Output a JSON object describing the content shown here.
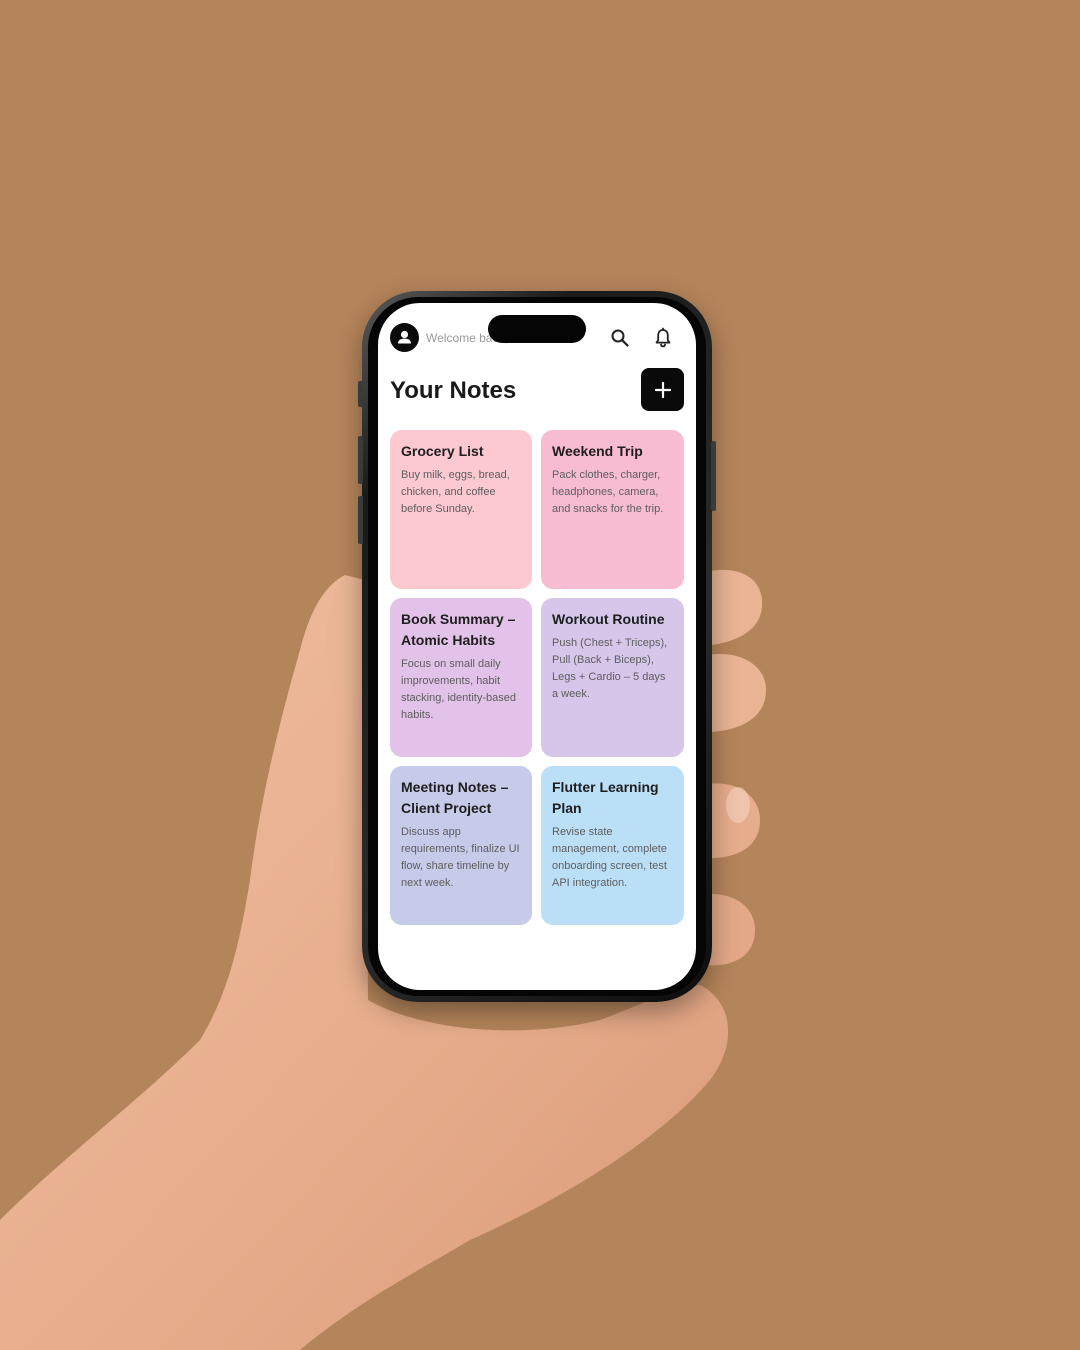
{
  "header": {
    "welcome_text": "Welcome back, Rahul",
    "title": "Your Notes",
    "add_label": "+"
  },
  "icons": {
    "avatar": "person-icon",
    "search": "search-icon",
    "notifications": "bell-icon",
    "add": "plus-icon"
  },
  "notes": [
    {
      "title": "Grocery List",
      "body": "Buy milk, eggs, bread, chicken, and coffee before Sunday.",
      "color": "#fcc9d1"
    },
    {
      "title": "Weekend Trip",
      "body": "Pack clothes, charger, headphones, camera, and snacks for the trip.",
      "color": "#f7bbd2"
    },
    {
      "title": "Book Summary – Atomic Habits",
      "body": "Focus on small daily improvements, habit stacking, identity-based habits.",
      "color": "#e2c2e9"
    },
    {
      "title": "Workout Routine",
      "body": "Push (Chest + Triceps), Pull (Back + Biceps), Legs + Cardio – 5 days a week.",
      "color": "#d6c6ea"
    },
    {
      "title": "Meeting Notes – Client Project",
      "body": "Discuss app requirements, finalize UI flow, share timeline by next week.",
      "color": "#c6cbe9"
    },
    {
      "title": "Flutter Learning Plan",
      "body": "Revise state management, complete onboarding screen, test API integration.",
      "color": "#bcdff8"
    }
  ],
  "colors": {
    "background": "#b4845a",
    "accent": "#0a0a0a",
    "skin": "#e8b090"
  }
}
